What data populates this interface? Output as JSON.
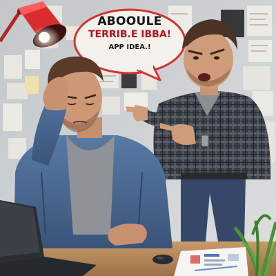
{
  "speech_bubble": {
    "line1": "ABOOULE",
    "line2": "TERRIB.E IBBA!",
    "line3": "APP IDEA.!"
  },
  "colors": {
    "wall": "#cfd2d4",
    "desk": "#b88a5c",
    "lamp": "#d92d2d",
    "denim_jacket": "#47648f",
    "plaid_shirt": "#3b3f47",
    "plant": "#4f8f3a",
    "bubble_accent": "#b3121b"
  }
}
